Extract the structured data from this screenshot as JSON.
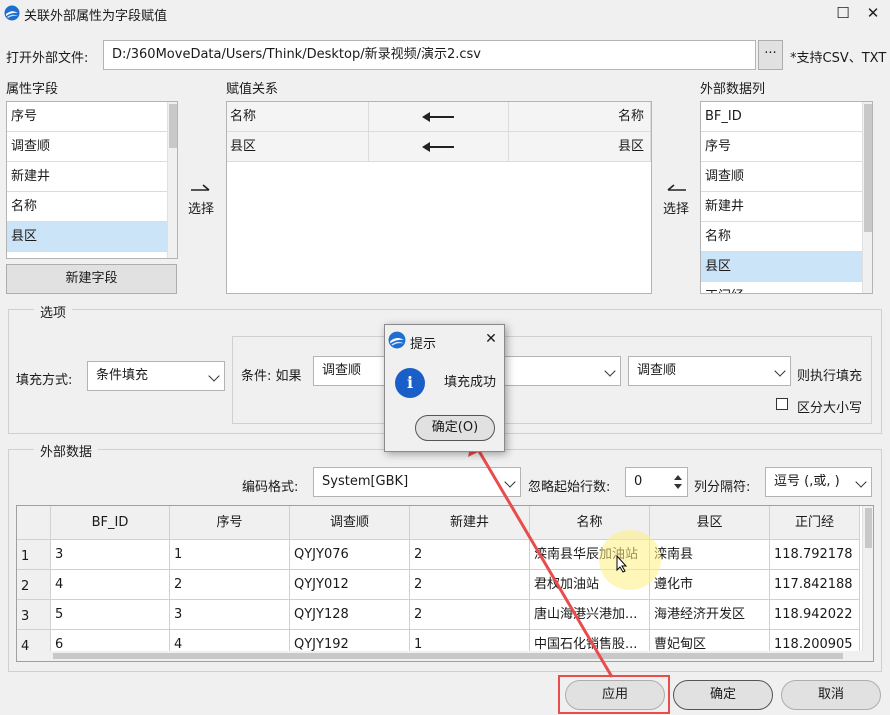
{
  "window": {
    "title": "关联外部属性为字段赋值",
    "maximize_icon": "maximize-icon",
    "close_icon": "close-icon"
  },
  "file": {
    "label": "打开外部文件:",
    "path": "D:/360MoveData/Users/Think/Desktop/新录视频/演示2.csv",
    "browse_label": "···",
    "hint": "*支持CSV、TXT"
  },
  "attr_fields": {
    "title": "属性字段",
    "items": [
      "序号",
      "调查顺",
      "新建井",
      "名称",
      "县区"
    ],
    "selected_index": 4,
    "new_field_button": "新建字段"
  },
  "select_left": {
    "label": "选择"
  },
  "mapping": {
    "title": "赋值关系",
    "rows": [
      {
        "target": "名称",
        "source": "名称"
      },
      {
        "target": "县区",
        "source": "县区"
      }
    ]
  },
  "select_right": {
    "label": "选择"
  },
  "ext_columns": {
    "title": "外部数据列",
    "items": [
      "BF_ID",
      "序号",
      "调查顺",
      "新建井",
      "名称",
      "县区",
      "正门经"
    ],
    "selected_index": 5
  },
  "options": {
    "title": "选项",
    "fill_mode_label": "填充方式:",
    "fill_mode_value": "条件填充",
    "condition_label": "条件: 如果",
    "cond_field1": "调查顺",
    "cond_op": "",
    "cond_field2": "调查顺",
    "then_label": "则执行填充",
    "case_label": "区分大小写"
  },
  "external": {
    "title": "外部数据",
    "encoding_label": "编码格式:",
    "encoding_value": "System[GBK]",
    "skip_label": "忽略起始行数:",
    "skip_value": "0",
    "sep_label": "列分隔符:",
    "sep_value": "逗号 (,或, )"
  },
  "table": {
    "columns": [
      "BF_ID",
      "序号",
      "调查顺",
      "新建井",
      "名称",
      "县区",
      "正门经"
    ],
    "rows": [
      {
        "n": "1",
        "cells": [
          "3",
          "1",
          "QYJY076",
          "2",
          "滦南县华辰加油站",
          "滦南县",
          "118.792178"
        ]
      },
      {
        "n": "2",
        "cells": [
          "4",
          "2",
          "QYJY012",
          "2",
          "君权加油站",
          "遵化市",
          "117.842188"
        ]
      },
      {
        "n": "3",
        "cells": [
          "5",
          "3",
          "QYJY128",
          "2",
          "唐山海港兴港加...",
          "海港经济开发区",
          "118.942022"
        ]
      },
      {
        "n": "4",
        "cells": [
          "6",
          "4",
          "QYJY192",
          "1",
          "中国石化销售股...",
          "曹妃甸区",
          "118.200905"
        ]
      }
    ]
  },
  "buttons": {
    "apply": "应用",
    "ok": "确定",
    "cancel": "取消"
  },
  "dialog": {
    "title": "提示",
    "message": "填充成功",
    "ok": "确定(O)",
    "info_icon": "info-icon"
  },
  "colors": {
    "selection": "#cce4f7",
    "annotation_red": "#e84c4c"
  }
}
